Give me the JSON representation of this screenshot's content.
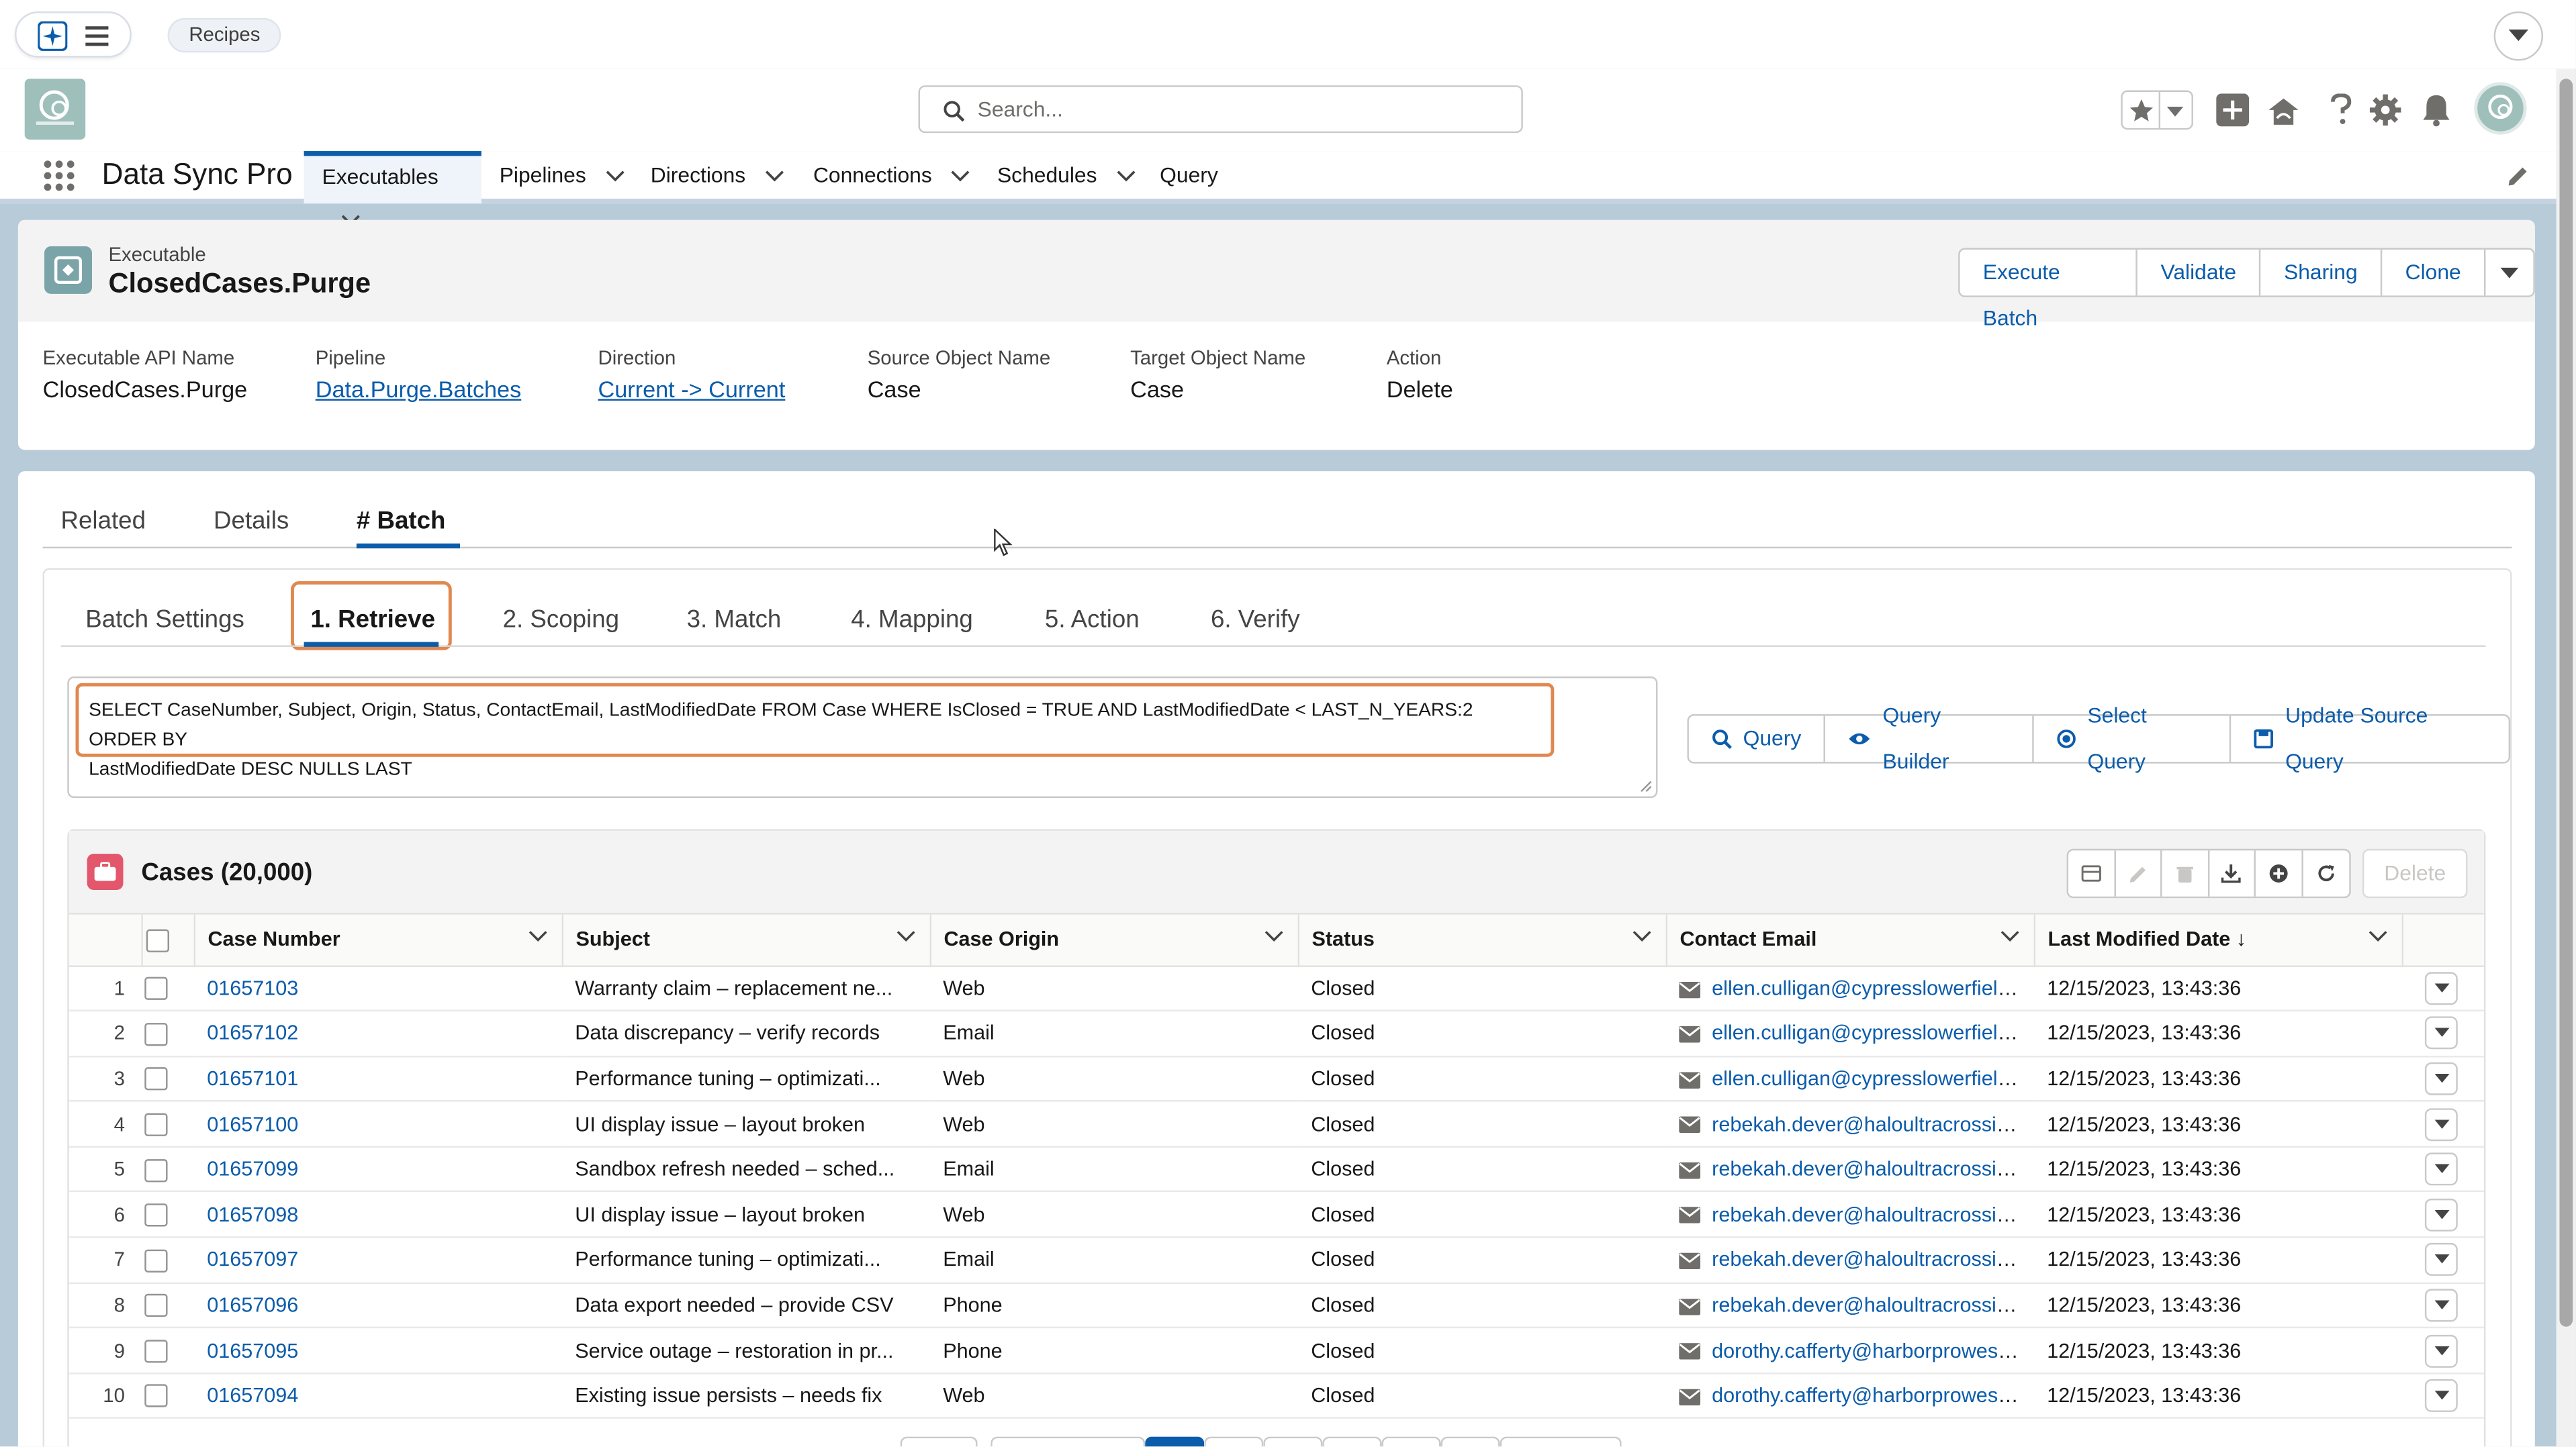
{
  "utility_bar": {
    "recipes_label": "Recipes"
  },
  "header": {
    "search_placeholder": "Search..."
  },
  "nav": {
    "app_name": "Data Sync Pro",
    "items": [
      {
        "label": "Executables",
        "active": true,
        "has_menu": true
      },
      {
        "label": "Pipelines",
        "active": false,
        "has_menu": true
      },
      {
        "label": "Directions",
        "active": false,
        "has_menu": true
      },
      {
        "label": "Connections",
        "active": false,
        "has_menu": true
      },
      {
        "label": "Schedules",
        "active": false,
        "has_menu": true
      },
      {
        "label": "Query",
        "active": false,
        "has_menu": false
      }
    ]
  },
  "record": {
    "object_label": "Executable",
    "title": "ClosedCases.Purge",
    "actions": [
      "Execute Batch",
      "Validate",
      "Sharing",
      "Clone"
    ],
    "fields": [
      {
        "label": "Executable API Name",
        "value": "ClosedCases.Purge",
        "link": false
      },
      {
        "label": "Pipeline",
        "value": "Data.Purge.Batches",
        "link": true
      },
      {
        "label": "Direction",
        "value": "Current -> Current",
        "link": true
      },
      {
        "label": "Source Object Name",
        "value": "Case",
        "link": false
      },
      {
        "label": "Target Object Name",
        "value": "Case",
        "link": false
      },
      {
        "label": "Action",
        "value": "Delete",
        "link": false
      }
    ]
  },
  "tabs": [
    "Related",
    "Details",
    "# Batch"
  ],
  "active_tab": "# Batch",
  "batch_tabs": [
    "Batch Settings",
    "1. Retrieve",
    "2. Scoping",
    "3. Match",
    "4. Mapping",
    "5. Action",
    "6. Verify"
  ],
  "active_batch_tab": "1. Retrieve",
  "query": {
    "text_line1": "SELECT CaseNumber, Subject, Origin, Status, ContactEmail, LastModifiedDate FROM Case WHERE IsClosed = TRUE AND LastModifiedDate < LAST_N_YEARS:2 ORDER BY",
    "text_line2": "LastModifiedDate DESC NULLS LAST",
    "buttons": [
      "Query",
      "Query Builder",
      "Select Query",
      "Update Source Query"
    ]
  },
  "list": {
    "title": "Cases (20,000)",
    "delete_label": "Delete",
    "columns": [
      "Case Number",
      "Subject",
      "Case Origin",
      "Status",
      "Contact Email",
      "Last Modified Date ↓"
    ],
    "rows": [
      {
        "n": "1",
        "case": "01657103",
        "subject": "Warranty claim – replacement ne...",
        "origin": "Web",
        "status": "Closed",
        "email": "ellen.culligan@cypresslowerfield.c...",
        "date": "12/15/2023, 13:43:36"
      },
      {
        "n": "2",
        "case": "01657102",
        "subject": "Data discrepancy – verify records",
        "origin": "Email",
        "status": "Closed",
        "email": "ellen.culligan@cypresslowerfield.c...",
        "date": "12/15/2023, 13:43:36"
      },
      {
        "n": "3",
        "case": "01657101",
        "subject": "Performance tuning – optimizati...",
        "origin": "Web",
        "status": "Closed",
        "email": "ellen.culligan@cypresslowerfield.c...",
        "date": "12/15/2023, 13:43:36"
      },
      {
        "n": "4",
        "case": "01657100",
        "subject": "UI display issue – layout broken",
        "origin": "Web",
        "status": "Closed",
        "email": "rebekah.dever@haloultracrossing....",
        "date": "12/15/2023, 13:43:36"
      },
      {
        "n": "5",
        "case": "01657099",
        "subject": "Sandbox refresh needed – sched...",
        "origin": "Email",
        "status": "Closed",
        "email": "rebekah.dever@haloultracrossing....",
        "date": "12/15/2023, 13:43:36"
      },
      {
        "n": "6",
        "case": "01657098",
        "subject": "UI display issue – layout broken",
        "origin": "Web",
        "status": "Closed",
        "email": "rebekah.dever@haloultracrossing....",
        "date": "12/15/2023, 13:43:36"
      },
      {
        "n": "7",
        "case": "01657097",
        "subject": "Performance tuning – optimizati...",
        "origin": "Email",
        "status": "Closed",
        "email": "rebekah.dever@haloultracrossing....",
        "date": "12/15/2023, 13:43:36"
      },
      {
        "n": "8",
        "case": "01657096",
        "subject": "Data export needed – provide CSV",
        "origin": "Phone",
        "status": "Closed",
        "email": "rebekah.dever@haloultracrossing....",
        "date": "12/15/2023, 13:43:36"
      },
      {
        "n": "9",
        "case": "01657095",
        "subject": "Service outage – restoration in pr...",
        "origin": "Phone",
        "status": "Closed",
        "email": "dorothy.cafferty@harborprowest....",
        "date": "12/15/2023, 13:43:36"
      },
      {
        "n": "10",
        "case": "01657094",
        "subject": "Existing issue persists – needs fix",
        "origin": "Web",
        "status": "Closed",
        "email": "dorothy.cafferty@harborprowest....",
        "date": "12/15/2023, 13:43:36"
      }
    ]
  },
  "colors": {
    "brand_blue": "#0b5cab",
    "highlight_orange": "#e0884f",
    "list_icon_pink": "#e3566c",
    "page_bg": "#b8cbd8"
  }
}
